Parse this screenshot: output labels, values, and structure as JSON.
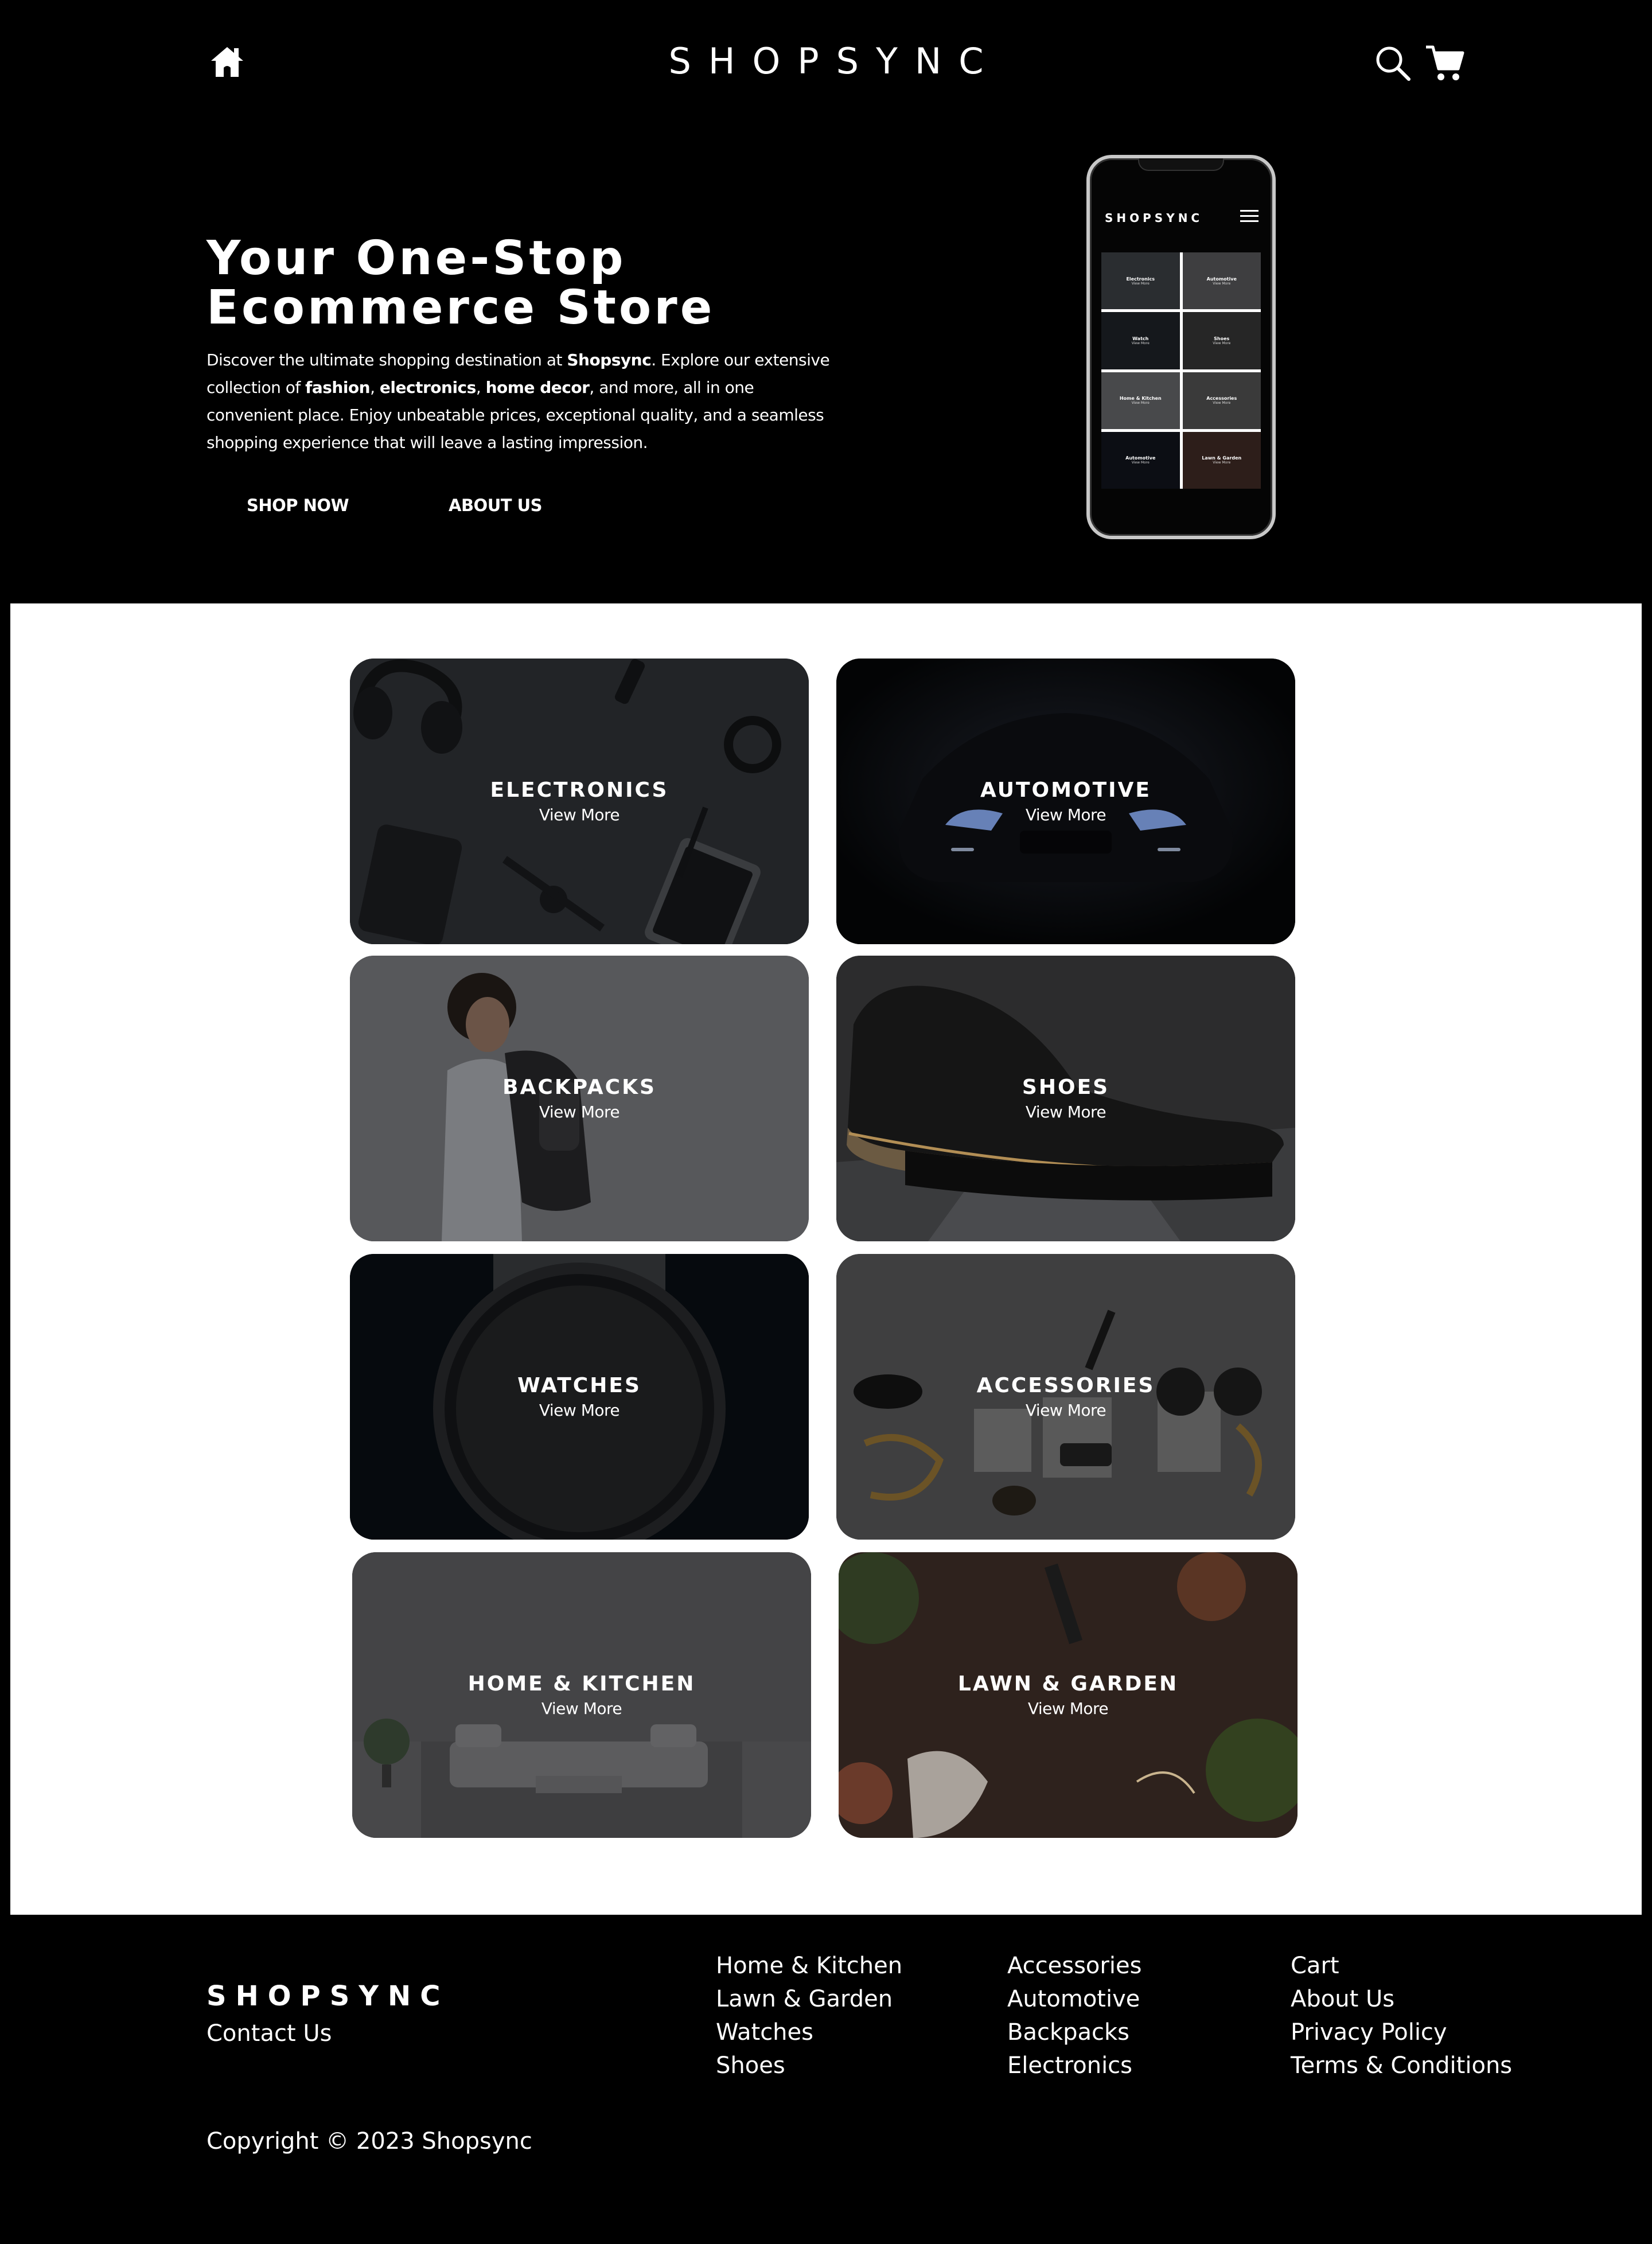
{
  "header": {
    "brand": "SHOPSYNC",
    "home_icon": "home-icon",
    "search_icon": "search-icon",
    "cart_icon": "cart-icon"
  },
  "hero": {
    "title_line1": "Your One-Stop",
    "title_line2": "Ecommerce Store",
    "desc": {
      "p1": "Discover the ultimate shopping destination at ",
      "brand": "Shopsync",
      "p2": ". Explore our extensive collection of ",
      "fashion": "fashion",
      "sep1": ", ",
      "electronics": "electronics",
      "sep2": ", ",
      "home_decor": "home decor",
      "p3": ", and more, all in one convenient place. Enjoy unbeatable prices, exceptional quality, and a seamless shopping experience that will leave a lasting impression."
    },
    "shop_now": "SHOP NOW",
    "about_us": "ABOUT US"
  },
  "phone": {
    "brand": "SHOPSYNC",
    "tiles": [
      {
        "title": "Electronics",
        "sub": "View More"
      },
      {
        "title": "Automotive",
        "sub": "View More"
      },
      {
        "title": "Watch",
        "sub": "View More"
      },
      {
        "title": "Shoes",
        "sub": "View More"
      },
      {
        "title": "Home & Kitchen",
        "sub": "View More"
      },
      {
        "title": "Accessories",
        "sub": "View More"
      },
      {
        "title": "Automotive",
        "sub": "View More"
      },
      {
        "title": "Lawn & Garden",
        "sub": "View More"
      }
    ]
  },
  "categories": [
    {
      "title": "ELECTRONICS",
      "link": "View More"
    },
    {
      "title": "AUTOMOTIVE",
      "link": "View More"
    },
    {
      "title": "BACKPACKS",
      "link": "View More"
    },
    {
      "title": "SHOES",
      "link": "View More"
    },
    {
      "title": "WATCHES",
      "link": "View More"
    },
    {
      "title": "ACCESSORIES",
      "link": "View More"
    },
    {
      "title": "HOME & KITCHEN",
      "link": "View More"
    },
    {
      "title": "LAWN & GARDEN",
      "link": "View More"
    }
  ],
  "footer": {
    "brand": "SHOPSYNC",
    "contact": "Contact Us",
    "col1": [
      "Home & Kitchen",
      "Lawn & Garden",
      "Watches",
      "Shoes"
    ],
    "col2": [
      "Accessories",
      "Automotive",
      "Backpacks",
      "Electronics"
    ],
    "col3": [
      "Cart",
      "About Us",
      "Privacy Policy",
      "Terms & Conditions"
    ],
    "copyright": "Copyright © 2023 Shopsync"
  },
  "colors": {
    "background": "#000000",
    "section_bg": "#ffffff",
    "text": "#ffffff"
  }
}
